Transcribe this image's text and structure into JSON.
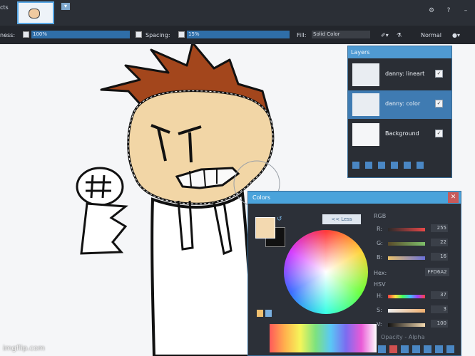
{
  "tabs": {
    "active_label": "cts"
  },
  "toolbar": {
    "softness_label": "ness:",
    "softness_value": "100%",
    "spacing_label": "Spacing:",
    "spacing_value": "15%",
    "fill_label": "Fill:",
    "fill_value": "Solid Color",
    "blend_value": "Normal"
  },
  "layers": {
    "title": "Layers",
    "items": [
      {
        "label": "danny: lineart",
        "visible": true,
        "selected": false
      },
      {
        "label": "danny: color",
        "visible": true,
        "selected": true
      },
      {
        "label": "Background",
        "visible": true,
        "selected": false
      }
    ]
  },
  "colors": {
    "title": "Colors",
    "less_button": "<< Less",
    "primary_color": "#f3d9b0",
    "secondary_color": "#111111",
    "rgb_header": "RGB",
    "r_label": "R:",
    "r_value": "255",
    "g_label": "G:",
    "g_value": "22",
    "b_label": "B:",
    "b_value": "16",
    "hex_label": "Hex:",
    "hex_value": "FFD6A2",
    "hsv_header": "HSV",
    "h_label": "H:",
    "h_value": "37",
    "s_label": "S:",
    "s_value": "3",
    "v_label": "V:",
    "v_value": "100",
    "opacity_label": "Opacity - Alpha"
  },
  "watermark": "imgflip.com"
}
